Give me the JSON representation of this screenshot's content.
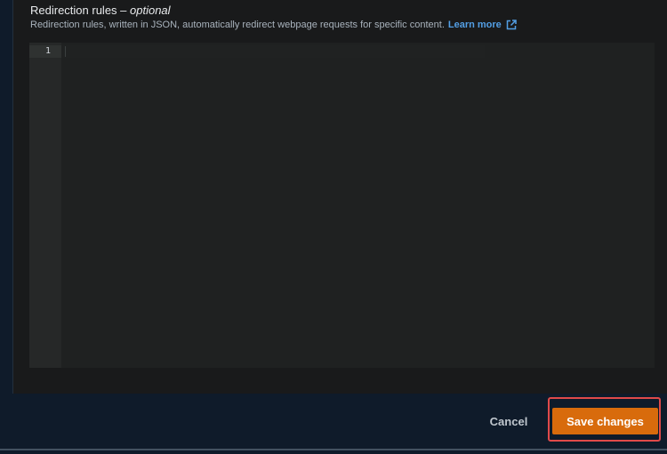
{
  "section": {
    "label": "Redirection rules",
    "label_separator": " – ",
    "optional_label": "optional",
    "description": "Redirection rules, written in JSON, automatically redirect webpage requests for specific content.",
    "learn_more": "Learn more",
    "learn_more_icon": "external-link-icon"
  },
  "editor": {
    "line_numbers": [
      "1"
    ],
    "content": ""
  },
  "footer": {
    "cancel_label": "Cancel",
    "save_label": "Save changes"
  },
  "colors": {
    "primary_button": "#d86b0c",
    "link": "#539fe5",
    "highlight_annotation": "#e04a4a"
  }
}
